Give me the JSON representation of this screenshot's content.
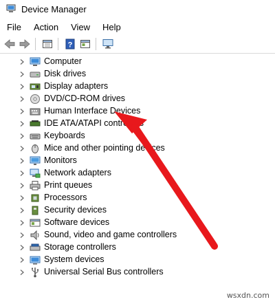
{
  "window": {
    "title": "Device Manager"
  },
  "menu": [
    "File",
    "Action",
    "View",
    "Help"
  ],
  "toolbar": {
    "buttons": [
      "back-icon",
      "forward-icon",
      "properties-icon",
      "help-icon",
      "view-icon",
      "monitor-icon"
    ]
  },
  "tree": {
    "items": [
      {
        "label": "Computer",
        "icon": "computer-icon"
      },
      {
        "label": "Disk drives",
        "icon": "disk-drive-icon"
      },
      {
        "label": "Display adapters",
        "icon": "display-adapter-icon"
      },
      {
        "label": "DVD/CD-ROM drives",
        "icon": "dvd-drive-icon"
      },
      {
        "label": "Human Interface Devices",
        "icon": "hid-icon"
      },
      {
        "label": "IDE ATA/ATAPI controllers",
        "icon": "ide-controller-icon"
      },
      {
        "label": "Keyboards",
        "icon": "keyboard-icon"
      },
      {
        "label": "Mice and other pointing devices",
        "icon": "mouse-icon"
      },
      {
        "label": "Monitors",
        "icon": "monitor-icon"
      },
      {
        "label": "Network adapters",
        "icon": "network-adapter-icon"
      },
      {
        "label": "Print queues",
        "icon": "printer-icon"
      },
      {
        "label": "Processors",
        "icon": "processor-icon"
      },
      {
        "label": "Security devices",
        "icon": "security-device-icon"
      },
      {
        "label": "Software devices",
        "icon": "software-device-icon"
      },
      {
        "label": "Sound, video and game controllers",
        "icon": "sound-icon"
      },
      {
        "label": "Storage controllers",
        "icon": "storage-controller-icon"
      },
      {
        "label": "System devices",
        "icon": "system-device-icon"
      },
      {
        "label": "Universal Serial Bus controllers",
        "icon": "usb-icon"
      }
    ]
  },
  "annotation": {
    "arrow_color": "#e8181c",
    "target": "Human Interface Devices"
  },
  "watermark": "wsxdn.com"
}
